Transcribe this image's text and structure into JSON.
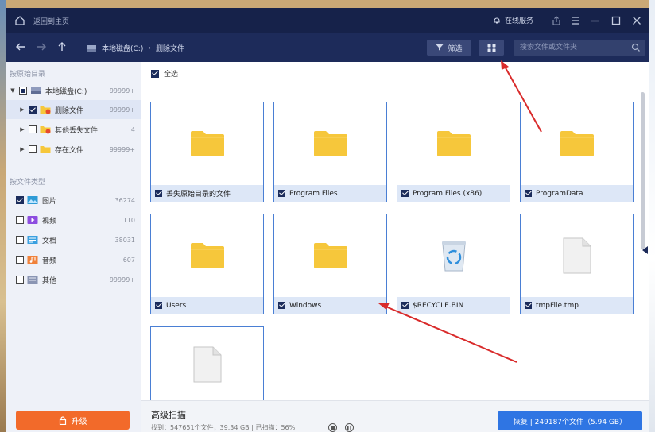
{
  "titlebar": {
    "back_home": "返回到主页",
    "service": "在线服务"
  },
  "navbar": {
    "breadcrumb": [
      "本地磁盘(C:)",
      "删除文件"
    ],
    "filter_label": "筛选",
    "search_placeholder": "搜索文件或文件夹"
  },
  "sidebar": {
    "section_original": "按原始目录",
    "tree": [
      {
        "label": "本地磁盘(C:)",
        "count": "99999+"
      },
      {
        "label": "删除文件",
        "count": "99999+"
      },
      {
        "label": "其他丢失文件",
        "count": "4"
      },
      {
        "label": "存在文件",
        "count": "99999+"
      }
    ],
    "section_type": "按文件类型",
    "types": [
      {
        "label": "图片",
        "count": "36274"
      },
      {
        "label": "视频",
        "count": "110"
      },
      {
        "label": "文档",
        "count": "38031"
      },
      {
        "label": "音频",
        "count": "607"
      },
      {
        "label": "其他",
        "count": "99999+"
      }
    ],
    "upgrade_label": "升级"
  },
  "content": {
    "select_all": "全选",
    "items": [
      {
        "name": "丢失原始目录的文件",
        "kind": "folder"
      },
      {
        "name": "Program Files",
        "kind": "folder"
      },
      {
        "name": "Program Files (x86)",
        "kind": "folder"
      },
      {
        "name": "ProgramData",
        "kind": "folder"
      },
      {
        "name": "Users",
        "kind": "folder"
      },
      {
        "name": "Windows",
        "kind": "folder"
      },
      {
        "name": "$RECYCLE.BIN",
        "kind": "recycle"
      },
      {
        "name": "tmpFile.tmp",
        "kind": "file"
      },
      {
        "name": "",
        "kind": "file"
      }
    ]
  },
  "bottom": {
    "title": "高级扫描",
    "progress": "找到：547651个文件，39.34 GB | 已扫描：56%",
    "recover_label": "恢复 | 249187个文件（5.94 GB）"
  },
  "colors": {
    "titlebar": "#16224a",
    "navbar": "#1d2b5a",
    "accent": "#2f75e3",
    "upgrade": "#f26a2a",
    "folder": "#f6c73b",
    "annotation_arrow": "#d92b2b"
  }
}
